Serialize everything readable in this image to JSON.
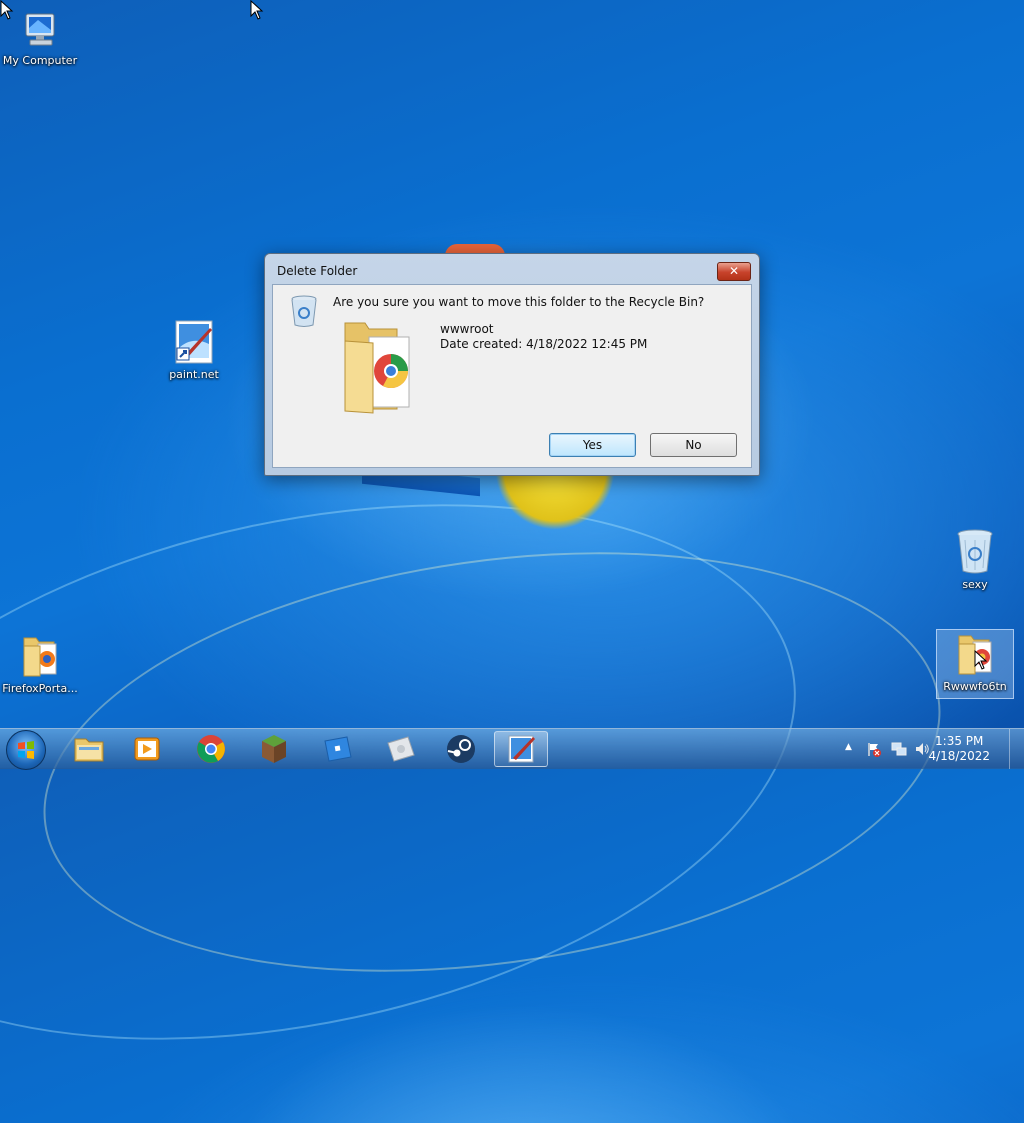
{
  "desktop": {
    "icons": [
      {
        "id": "my-computer",
        "label": "My Computer",
        "icon": "computer-icon"
      },
      {
        "id": "paintnet",
        "label": "paint.net",
        "icon": "paintnet-icon"
      },
      {
        "id": "firefox-portable",
        "label": "FirefoxPorta...",
        "icon": "folder-icon"
      },
      {
        "id": "recycle-bin",
        "label": "sexy",
        "icon": "recycle-bin-icon"
      },
      {
        "id": "wwwroot-folder",
        "label": "Rwwwfo6tn",
        "icon": "folder-icon"
      }
    ]
  },
  "dialog": {
    "title": "Delete Folder",
    "close_label": "✕",
    "question": "Are you sure you want to move this folder to the Recycle Bin?",
    "folder_name": "wwwroot",
    "date_created": "Date created: 4/18/2022 12:45 PM",
    "yes_label": "Yes",
    "no_label": "No"
  },
  "taskbar": {
    "pinned": [
      "explorer-icon",
      "media-player-icon",
      "chrome-icon",
      "minecraft-icon",
      "roblox-icon",
      "app-icon",
      "steam-icon",
      "paintnet-icon"
    ],
    "active": "paintnet-icon",
    "clock": {
      "time": "1:35 PM",
      "date": "4/18/2022"
    }
  },
  "colors": {
    "accent": "#1f74d2",
    "close_button": "#c7422b"
  }
}
